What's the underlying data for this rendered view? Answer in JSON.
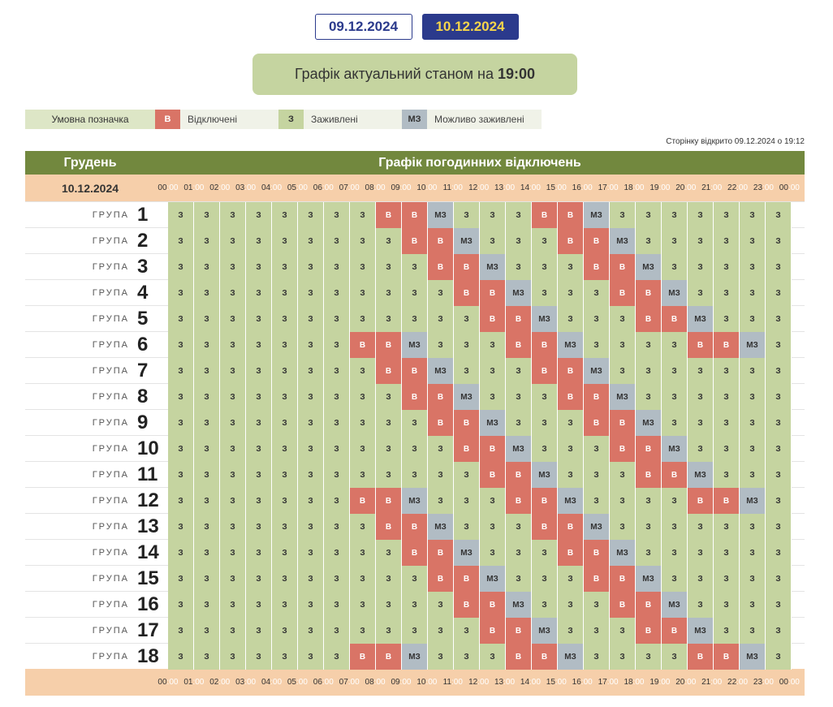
{
  "dates": [
    "09.12.2024",
    "10.12.2024"
  ],
  "status": {
    "prefix": "Графік актуальний станом на",
    "time": "19:00"
  },
  "legend": {
    "label": "Умовна позначка",
    "items": [
      {
        "code": "В",
        "text": "Відключені",
        "cls": "v"
      },
      {
        "code": "З",
        "text": "Заживлені",
        "cls": "z"
      },
      {
        "code": "МЗ",
        "text": "Можливо заживлені",
        "cls": "mz"
      }
    ]
  },
  "opened": "Сторінку відкрито 09.12.2024 о 19:12",
  "table": {
    "month": "Грудень",
    "title": "Графік погодинних відключень",
    "date": "10.12.2024",
    "group_word": "ГРУПА",
    "hours": [
      "00",
      "01",
      "02",
      "03",
      "04",
      "05",
      "06",
      "07",
      "08",
      "09",
      "10",
      "11",
      "12",
      "13",
      "14",
      "15",
      "16",
      "17",
      "18",
      "19",
      "20",
      "21",
      "22",
      "23",
      "00"
    ],
    "hour_suffix": ":00",
    "codes": {
      "z": "З",
      "v": "В",
      "mz": "МЗ"
    },
    "groups": [
      {
        "n": "1",
        "cells": [
          "z",
          "z",
          "z",
          "z",
          "z",
          "z",
          "z",
          "z",
          "v",
          "v",
          "mz",
          "z",
          "z",
          "z",
          "v",
          "v",
          "mz",
          "z",
          "z",
          "z",
          "z",
          "z",
          "z",
          "z"
        ]
      },
      {
        "n": "2",
        "cells": [
          "z",
          "z",
          "z",
          "z",
          "z",
          "z",
          "z",
          "z",
          "z",
          "v",
          "v",
          "mz",
          "z",
          "z",
          "z",
          "v",
          "v",
          "mz",
          "z",
          "z",
          "z",
          "z",
          "z",
          "z"
        ]
      },
      {
        "n": "3",
        "cells": [
          "z",
          "z",
          "z",
          "z",
          "z",
          "z",
          "z",
          "z",
          "z",
          "z",
          "v",
          "v",
          "mz",
          "z",
          "z",
          "z",
          "v",
          "v",
          "mz",
          "z",
          "z",
          "z",
          "z",
          "z"
        ]
      },
      {
        "n": "4",
        "cells": [
          "z",
          "z",
          "z",
          "z",
          "z",
          "z",
          "z",
          "z",
          "z",
          "z",
          "z",
          "v",
          "v",
          "mz",
          "z",
          "z",
          "z",
          "v",
          "v",
          "mz",
          "z",
          "z",
          "z",
          "z"
        ]
      },
      {
        "n": "5",
        "cells": [
          "z",
          "z",
          "z",
          "z",
          "z",
          "z",
          "z",
          "z",
          "z",
          "z",
          "z",
          "z",
          "v",
          "v",
          "mz",
          "z",
          "z",
          "z",
          "v",
          "v",
          "mz",
          "z",
          "z",
          "z"
        ]
      },
      {
        "n": "6",
        "cells": [
          "z",
          "z",
          "z",
          "z",
          "z",
          "z",
          "z",
          "v",
          "v",
          "mz",
          "z",
          "z",
          "z",
          "v",
          "v",
          "mz",
          "z",
          "z",
          "z",
          "z",
          "v",
          "v",
          "mz",
          "z"
        ]
      },
      {
        "n": "7",
        "cells": [
          "z",
          "z",
          "z",
          "z",
          "z",
          "z",
          "z",
          "z",
          "v",
          "v",
          "mz",
          "z",
          "z",
          "z",
          "v",
          "v",
          "mz",
          "z",
          "z",
          "z",
          "z",
          "z",
          "z",
          "z"
        ]
      },
      {
        "n": "8",
        "cells": [
          "z",
          "z",
          "z",
          "z",
          "z",
          "z",
          "z",
          "z",
          "z",
          "v",
          "v",
          "mz",
          "z",
          "z",
          "z",
          "v",
          "v",
          "mz",
          "z",
          "z",
          "z",
          "z",
          "z",
          "z"
        ]
      },
      {
        "n": "9",
        "cells": [
          "z",
          "z",
          "z",
          "z",
          "z",
          "z",
          "z",
          "z",
          "z",
          "z",
          "v",
          "v",
          "mz",
          "z",
          "z",
          "z",
          "v",
          "v",
          "mz",
          "z",
          "z",
          "z",
          "z",
          "z"
        ]
      },
      {
        "n": "10",
        "cells": [
          "z",
          "z",
          "z",
          "z",
          "z",
          "z",
          "z",
          "z",
          "z",
          "z",
          "z",
          "v",
          "v",
          "mz",
          "z",
          "z",
          "z",
          "v",
          "v",
          "mz",
          "z",
          "z",
          "z",
          "z"
        ]
      },
      {
        "n": "11",
        "cells": [
          "z",
          "z",
          "z",
          "z",
          "z",
          "z",
          "z",
          "z",
          "z",
          "z",
          "z",
          "z",
          "v",
          "v",
          "mz",
          "z",
          "z",
          "z",
          "v",
          "v",
          "mz",
          "z",
          "z",
          "z"
        ]
      },
      {
        "n": "12",
        "cells": [
          "z",
          "z",
          "z",
          "z",
          "z",
          "z",
          "z",
          "v",
          "v",
          "mz",
          "z",
          "z",
          "z",
          "v",
          "v",
          "mz",
          "z",
          "z",
          "z",
          "z",
          "v",
          "v",
          "mz",
          "z"
        ]
      },
      {
        "n": "13",
        "cells": [
          "z",
          "z",
          "z",
          "z",
          "z",
          "z",
          "z",
          "z",
          "v",
          "v",
          "mz",
          "z",
          "z",
          "z",
          "v",
          "v",
          "mz",
          "z",
          "z",
          "z",
          "z",
          "z",
          "z",
          "z"
        ]
      },
      {
        "n": "14",
        "cells": [
          "z",
          "z",
          "z",
          "z",
          "z",
          "z",
          "z",
          "z",
          "z",
          "v",
          "v",
          "mz",
          "z",
          "z",
          "z",
          "v",
          "v",
          "mz",
          "z",
          "z",
          "z",
          "z",
          "z",
          "z"
        ]
      },
      {
        "n": "15",
        "cells": [
          "z",
          "z",
          "z",
          "z",
          "z",
          "z",
          "z",
          "z",
          "z",
          "z",
          "v",
          "v",
          "mz",
          "z",
          "z",
          "z",
          "v",
          "v",
          "mz",
          "z",
          "z",
          "z",
          "z",
          "z"
        ]
      },
      {
        "n": "16",
        "cells": [
          "z",
          "z",
          "z",
          "z",
          "z",
          "z",
          "z",
          "z",
          "z",
          "z",
          "z",
          "v",
          "v",
          "mz",
          "z",
          "z",
          "z",
          "v",
          "v",
          "mz",
          "z",
          "z",
          "z",
          "z"
        ]
      },
      {
        "n": "17",
        "cells": [
          "z",
          "z",
          "z",
          "z",
          "z",
          "z",
          "z",
          "z",
          "z",
          "z",
          "z",
          "z",
          "v",
          "v",
          "mz",
          "z",
          "z",
          "z",
          "v",
          "v",
          "mz",
          "z",
          "z",
          "z"
        ]
      },
      {
        "n": "18",
        "cells": [
          "z",
          "z",
          "z",
          "z",
          "z",
          "z",
          "z",
          "v",
          "v",
          "mz",
          "z",
          "z",
          "z",
          "v",
          "v",
          "mz",
          "z",
          "z",
          "z",
          "z",
          "v",
          "v",
          "mz",
          "z"
        ]
      }
    ]
  }
}
